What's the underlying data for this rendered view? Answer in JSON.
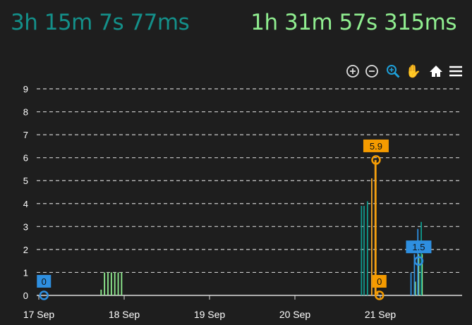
{
  "header": {
    "timer_left": "3h 15m 7s 77ms",
    "timer_right": "1h 31m 57s 315ms",
    "color_left": "#14908a",
    "color_right": "#90ee90"
  },
  "toolbar": {
    "icons": [
      "zoom-in-icon",
      "zoom-out-icon",
      "selection-zoom-icon",
      "pan-hand-icon",
      "home-reset-icon",
      "menu-icon"
    ]
  },
  "chart_data": {
    "type": "bar",
    "title": "",
    "xlabel": "",
    "ylabel": "",
    "x_unit": "days since 17 Sep",
    "xlim": [
      -0.1,
      4.95
    ],
    "ylim": [
      0,
      9
    ],
    "yticks": [
      "0",
      "1",
      "2",
      "3",
      "4",
      "5",
      "6",
      "7",
      "8",
      "9"
    ],
    "xticks": [
      {
        "v": 0,
        "label": "17 Sep"
      },
      {
        "v": 1,
        "label": "18 Sep"
      },
      {
        "v": 2,
        "label": "19 Sep"
      },
      {
        "v": 3,
        "label": "20 Sep"
      },
      {
        "v": 4,
        "label": "21 Sep"
      }
    ],
    "grid": true,
    "series": [
      {
        "name": "green",
        "color": "#90ee90",
        "points": [
          [
            0.73,
            0.25
          ],
          [
            0.77,
            1
          ],
          [
            0.81,
            1
          ],
          [
            0.85,
            1
          ],
          [
            0.89,
            1
          ],
          [
            0.93,
            1
          ],
          [
            0.97,
            1
          ],
          [
            4.41,
            0.6
          ],
          [
            4.45,
            1.8
          ],
          [
            4.49,
            1.8
          ]
        ]
      },
      {
        "name": "teal",
        "color": "#0f9b8e",
        "points": [
          [
            3.78,
            3.9
          ],
          [
            3.81,
            3.9
          ],
          [
            3.85,
            4.1
          ],
          [
            4.48,
            3.2
          ]
        ]
      },
      {
        "name": "orange",
        "color": "#f5a623",
        "points": [
          [
            3.9,
            5.1
          ],
          [
            3.94,
            5.9
          ],
          [
            3.97,
            0.2
          ]
        ]
      },
      {
        "name": "blue",
        "color": "#2e8fe0",
        "points": [
          [
            4.36,
            1.0
          ],
          [
            4.4,
            1.8
          ],
          [
            4.44,
            2.9
          ]
        ]
      }
    ],
    "annotations": [
      {
        "x": 0.06,
        "y": 0,
        "label": "0",
        "color": "#2e8fe0"
      },
      {
        "x": 3.95,
        "y": 5.9,
        "label": "5.9",
        "color": "#f59b00"
      },
      {
        "x": 3.99,
        "y": 0,
        "label": "0",
        "color": "#f59b00"
      },
      {
        "x": 4.45,
        "y": 1.5,
        "label": "1.5",
        "color": "#2e8fe0"
      }
    ]
  }
}
